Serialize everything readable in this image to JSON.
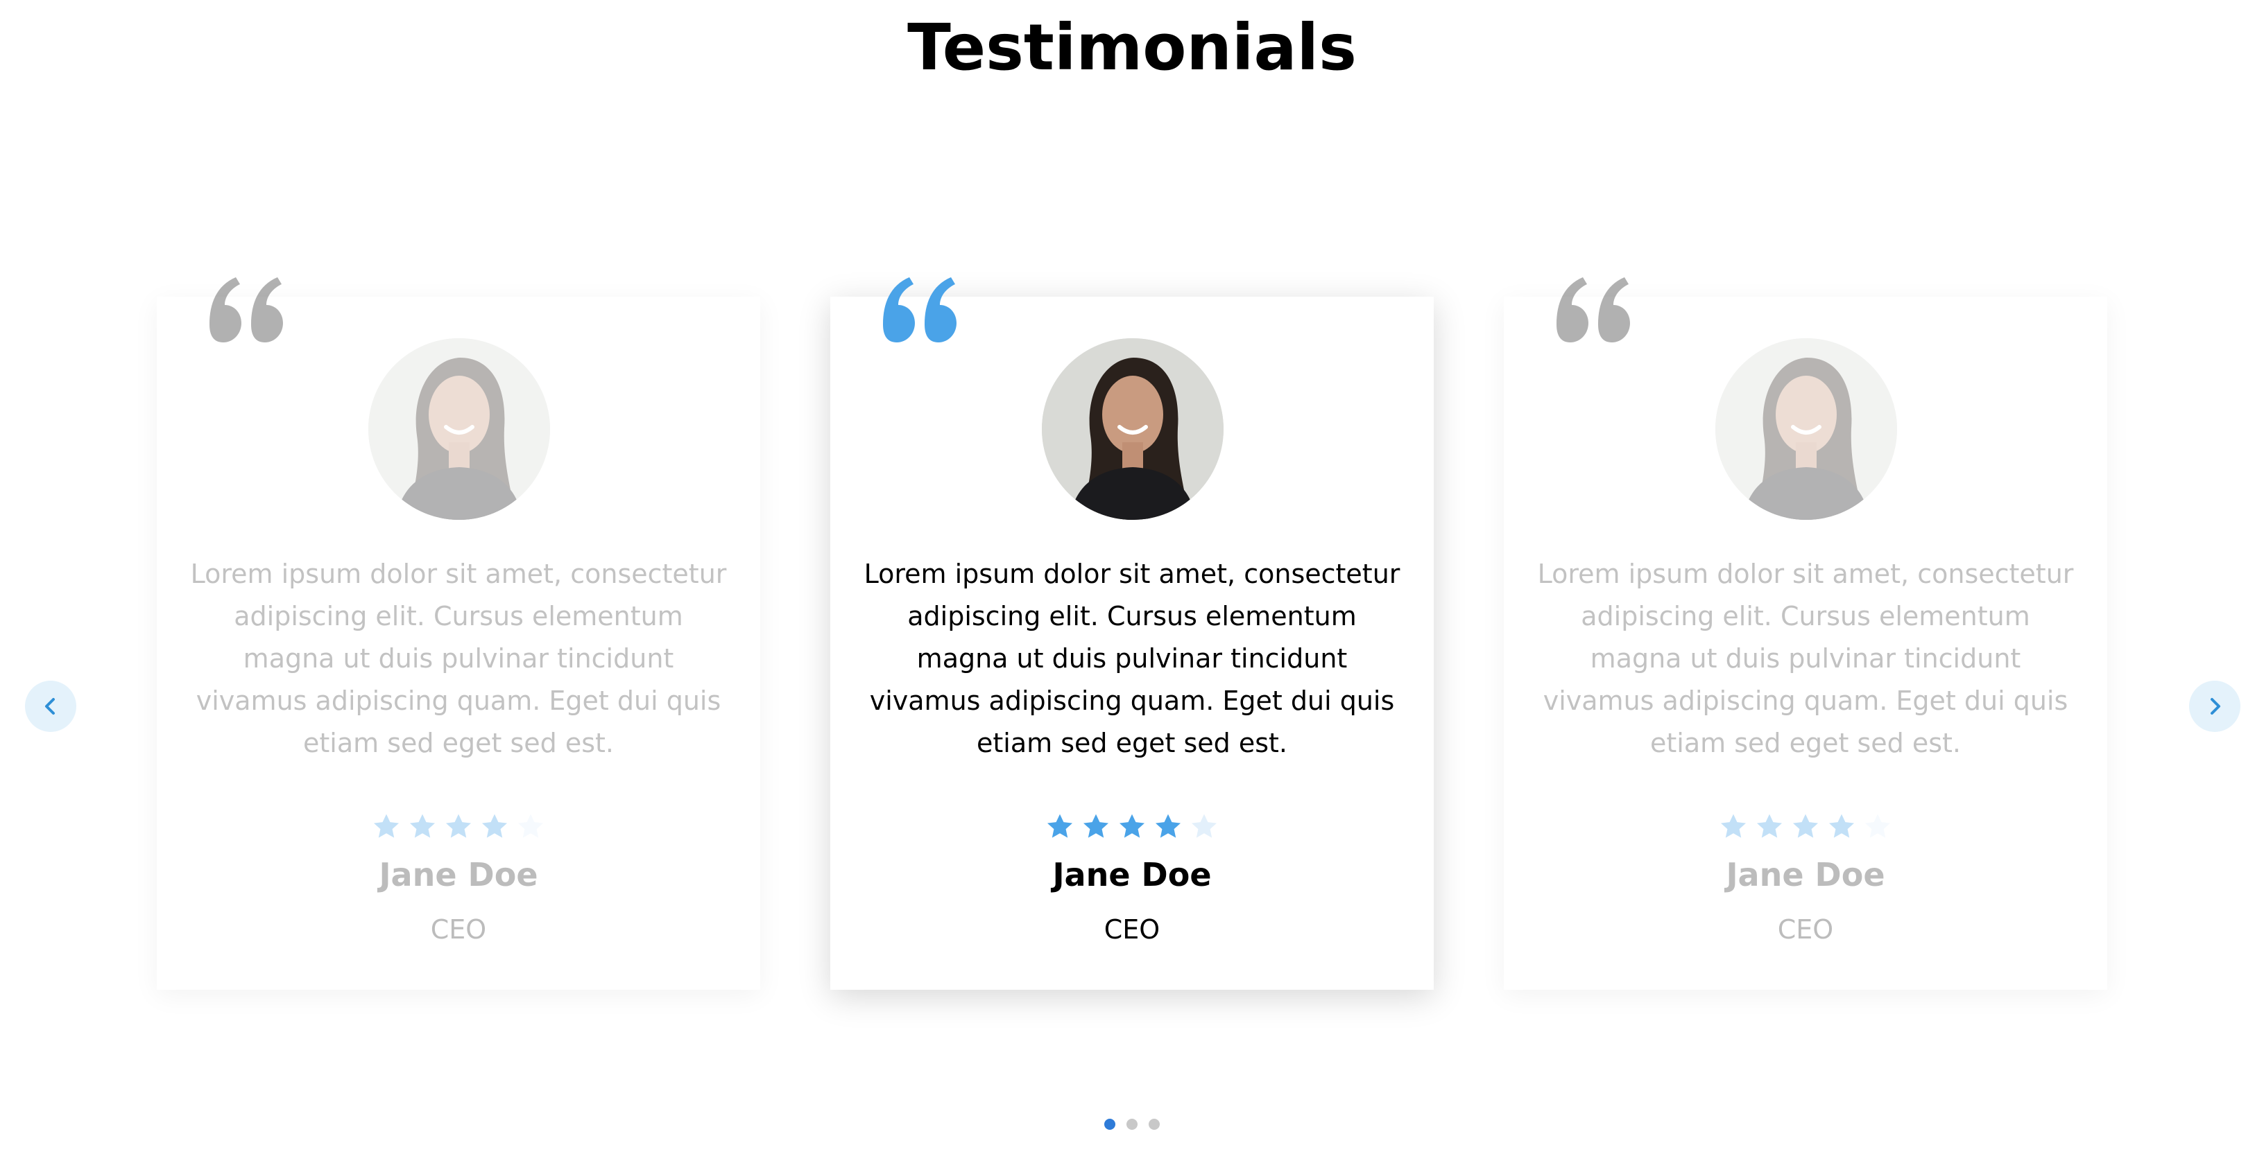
{
  "section": {
    "title": "Testimonials"
  },
  "colors": {
    "accent": "#4aa3e8",
    "quote_inactive": "#a9a9a9",
    "arrow_bg": "#e4f2fb",
    "dot_active": "#2e7bd8",
    "dot_inactive": "#c8c8c8"
  },
  "testimonials": [
    {
      "state": "inactive",
      "quote_icon": "quote-mark-icon",
      "avatar": "avatar-jane-doe",
      "text": "Lorem ipsum dolor sit amet, consectetur adipiscing elit. Cursus elementum magna ut duis pulvinar tincidunt vivamus adipiscing quam. Eget dui quis etiam sed eget sed est.",
      "rating": 4,
      "rating_max": 5,
      "name": "Jane Doe",
      "role": "CEO"
    },
    {
      "state": "active",
      "quote_icon": "quote-mark-icon",
      "avatar": "avatar-jane-doe",
      "text": "Lorem ipsum dolor sit amet, consectetur adipiscing elit. Cursus elementum magna ut duis pulvinar tincidunt vivamus adipiscing quam. Eget dui quis etiam sed eget sed est.",
      "rating": 4,
      "rating_max": 5,
      "name": "Jane Doe",
      "role": "CEO"
    },
    {
      "state": "inactive",
      "quote_icon": "quote-mark-icon",
      "avatar": "avatar-jane-doe",
      "text": "Lorem ipsum dolor sit amet, consectetur adipiscing elit. Cursus elementum magna ut duis pulvinar tincidunt vivamus adipiscing quam. Eget dui quis etiam sed eget sed est.",
      "rating": 4,
      "rating_max": 5,
      "name": "Jane Doe",
      "role": "CEO"
    }
  ],
  "navigation": {
    "prev_icon": "chevron-left-icon",
    "next_icon": "chevron-right-icon"
  },
  "pagination": {
    "total": 3,
    "active_index": 0
  }
}
